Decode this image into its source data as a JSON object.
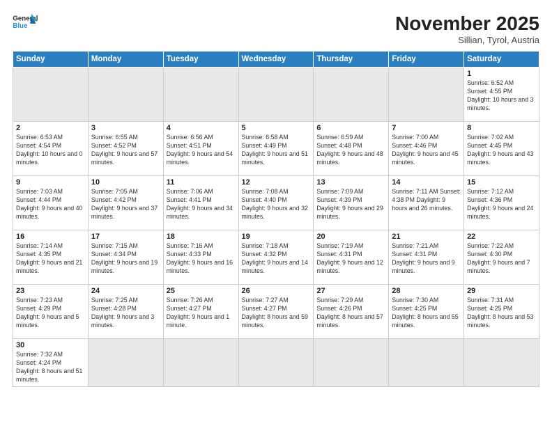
{
  "header": {
    "logo_general": "General",
    "logo_blue": "Blue",
    "month_title": "November 2025",
    "subtitle": "Sillian, Tyrol, Austria"
  },
  "weekdays": [
    "Sunday",
    "Monday",
    "Tuesday",
    "Wednesday",
    "Thursday",
    "Friday",
    "Saturday"
  ],
  "weeks": [
    [
      {
        "num": "",
        "info": "",
        "empty": true
      },
      {
        "num": "",
        "info": "",
        "empty": true
      },
      {
        "num": "",
        "info": "",
        "empty": true
      },
      {
        "num": "",
        "info": "",
        "empty": true
      },
      {
        "num": "",
        "info": "",
        "empty": true
      },
      {
        "num": "",
        "info": "",
        "empty": true
      },
      {
        "num": "1",
        "info": "Sunrise: 6:52 AM\nSunset: 4:55 PM\nDaylight: 10 hours\nand 3 minutes."
      }
    ],
    [
      {
        "num": "2",
        "info": "Sunrise: 6:53 AM\nSunset: 4:54 PM\nDaylight: 10 hours\nand 0 minutes."
      },
      {
        "num": "3",
        "info": "Sunrise: 6:55 AM\nSunset: 4:52 PM\nDaylight: 9 hours\nand 57 minutes."
      },
      {
        "num": "4",
        "info": "Sunrise: 6:56 AM\nSunset: 4:51 PM\nDaylight: 9 hours\nand 54 minutes."
      },
      {
        "num": "5",
        "info": "Sunrise: 6:58 AM\nSunset: 4:49 PM\nDaylight: 9 hours\nand 51 minutes."
      },
      {
        "num": "6",
        "info": "Sunrise: 6:59 AM\nSunset: 4:48 PM\nDaylight: 9 hours\nand 48 minutes."
      },
      {
        "num": "7",
        "info": "Sunrise: 7:00 AM\nSunset: 4:46 PM\nDaylight: 9 hours\nand 45 minutes."
      },
      {
        "num": "8",
        "info": "Sunrise: 7:02 AM\nSunset: 4:45 PM\nDaylight: 9 hours\nand 43 minutes."
      }
    ],
    [
      {
        "num": "9",
        "info": "Sunrise: 7:03 AM\nSunset: 4:44 PM\nDaylight: 9 hours\nand 40 minutes."
      },
      {
        "num": "10",
        "info": "Sunrise: 7:05 AM\nSunset: 4:42 PM\nDaylight: 9 hours\nand 37 minutes."
      },
      {
        "num": "11",
        "info": "Sunrise: 7:06 AM\nSunset: 4:41 PM\nDaylight: 9 hours\nand 34 minutes."
      },
      {
        "num": "12",
        "info": "Sunrise: 7:08 AM\nSunset: 4:40 PM\nDaylight: 9 hours\nand 32 minutes."
      },
      {
        "num": "13",
        "info": "Sunrise: 7:09 AM\nSunset: 4:39 PM\nDaylight: 9 hours\nand 29 minutes."
      },
      {
        "num": "14",
        "info": "Sunrise: 7:11 AM\nSunset: 4:38 PM\nDaylight: 9 hours\nand 26 minutes."
      },
      {
        "num": "15",
        "info": "Sunrise: 7:12 AM\nSunset: 4:36 PM\nDaylight: 9 hours\nand 24 minutes."
      }
    ],
    [
      {
        "num": "16",
        "info": "Sunrise: 7:14 AM\nSunset: 4:35 PM\nDaylight: 9 hours\nand 21 minutes."
      },
      {
        "num": "17",
        "info": "Sunrise: 7:15 AM\nSunset: 4:34 PM\nDaylight: 9 hours\nand 19 minutes."
      },
      {
        "num": "18",
        "info": "Sunrise: 7:16 AM\nSunset: 4:33 PM\nDaylight: 9 hours\nand 16 minutes."
      },
      {
        "num": "19",
        "info": "Sunrise: 7:18 AM\nSunset: 4:32 PM\nDaylight: 9 hours\nand 14 minutes."
      },
      {
        "num": "20",
        "info": "Sunrise: 7:19 AM\nSunset: 4:31 PM\nDaylight: 9 hours\nand 12 minutes."
      },
      {
        "num": "21",
        "info": "Sunrise: 7:21 AM\nSunset: 4:31 PM\nDaylight: 9 hours\nand 9 minutes."
      },
      {
        "num": "22",
        "info": "Sunrise: 7:22 AM\nSunset: 4:30 PM\nDaylight: 9 hours\nand 7 minutes."
      }
    ],
    [
      {
        "num": "23",
        "info": "Sunrise: 7:23 AM\nSunset: 4:29 PM\nDaylight: 9 hours\nand 5 minutes."
      },
      {
        "num": "24",
        "info": "Sunrise: 7:25 AM\nSunset: 4:28 PM\nDaylight: 9 hours\nand 3 minutes."
      },
      {
        "num": "25",
        "info": "Sunrise: 7:26 AM\nSunset: 4:27 PM\nDaylight: 9 hours\nand 1 minute."
      },
      {
        "num": "26",
        "info": "Sunrise: 7:27 AM\nSunset: 4:27 PM\nDaylight: 8 hours\nand 59 minutes."
      },
      {
        "num": "27",
        "info": "Sunrise: 7:29 AM\nSunset: 4:26 PM\nDaylight: 8 hours\nand 57 minutes."
      },
      {
        "num": "28",
        "info": "Sunrise: 7:30 AM\nSunset: 4:25 PM\nDaylight: 8 hours\nand 55 minutes."
      },
      {
        "num": "29",
        "info": "Sunrise: 7:31 AM\nSunset: 4:25 PM\nDaylight: 8 hours\nand 53 minutes."
      }
    ],
    [
      {
        "num": "30",
        "info": "Sunrise: 7:32 AM\nSunset: 4:24 PM\nDaylight: 8 hours\nand 51 minutes.",
        "last": true
      },
      {
        "num": "",
        "info": "",
        "empty": true,
        "last": true
      },
      {
        "num": "",
        "info": "",
        "empty": true,
        "last": true
      },
      {
        "num": "",
        "info": "",
        "empty": true,
        "last": true
      },
      {
        "num": "",
        "info": "",
        "empty": true,
        "last": true
      },
      {
        "num": "",
        "info": "",
        "empty": true,
        "last": true
      },
      {
        "num": "",
        "info": "",
        "empty": true,
        "last": true
      }
    ]
  ]
}
